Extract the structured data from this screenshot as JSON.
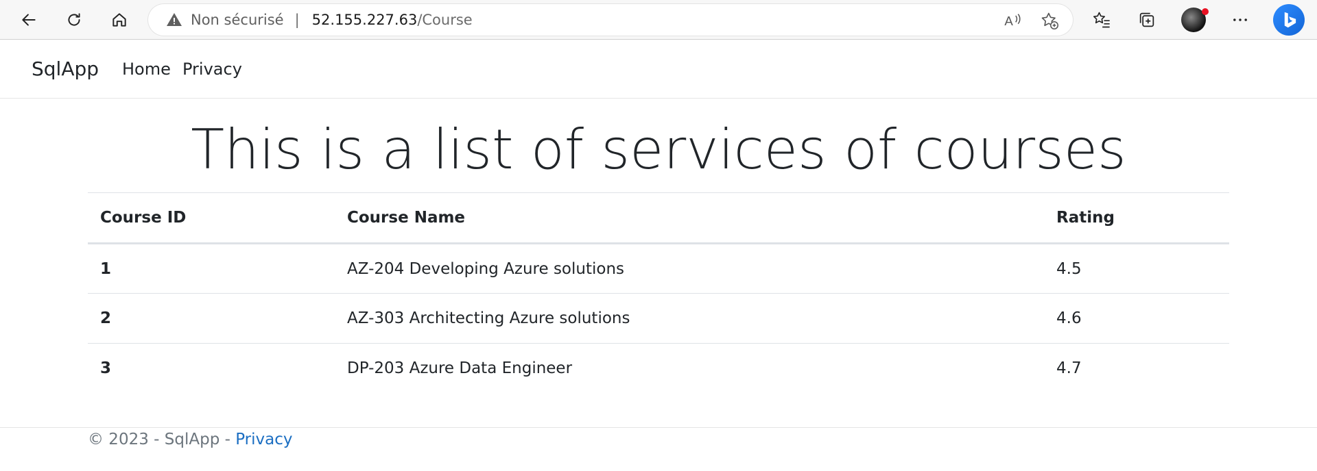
{
  "browser": {
    "security_label": "Non sécurisé",
    "url_host": "52.155.227.63",
    "url_path": "/Course"
  },
  "app": {
    "brand": "SqlApp",
    "nav": [
      {
        "label": "Home"
      },
      {
        "label": "Privacy"
      }
    ]
  },
  "main": {
    "title": "This is a list of services of courses",
    "table": {
      "headers": [
        "Course ID",
        "Course Name",
        "Rating"
      ],
      "rows": [
        {
          "id": "1",
          "name": "AZ-204 Developing Azure solutions",
          "rating": "4.5"
        },
        {
          "id": "2",
          "name": "AZ-303 Architecting Azure solutions",
          "rating": "4.6"
        },
        {
          "id": "3",
          "name": "DP-203 Azure Data Engineer",
          "rating": "4.7"
        }
      ]
    }
  },
  "footer": {
    "text": "© 2023 - SqlApp - ",
    "link": "Privacy"
  }
}
